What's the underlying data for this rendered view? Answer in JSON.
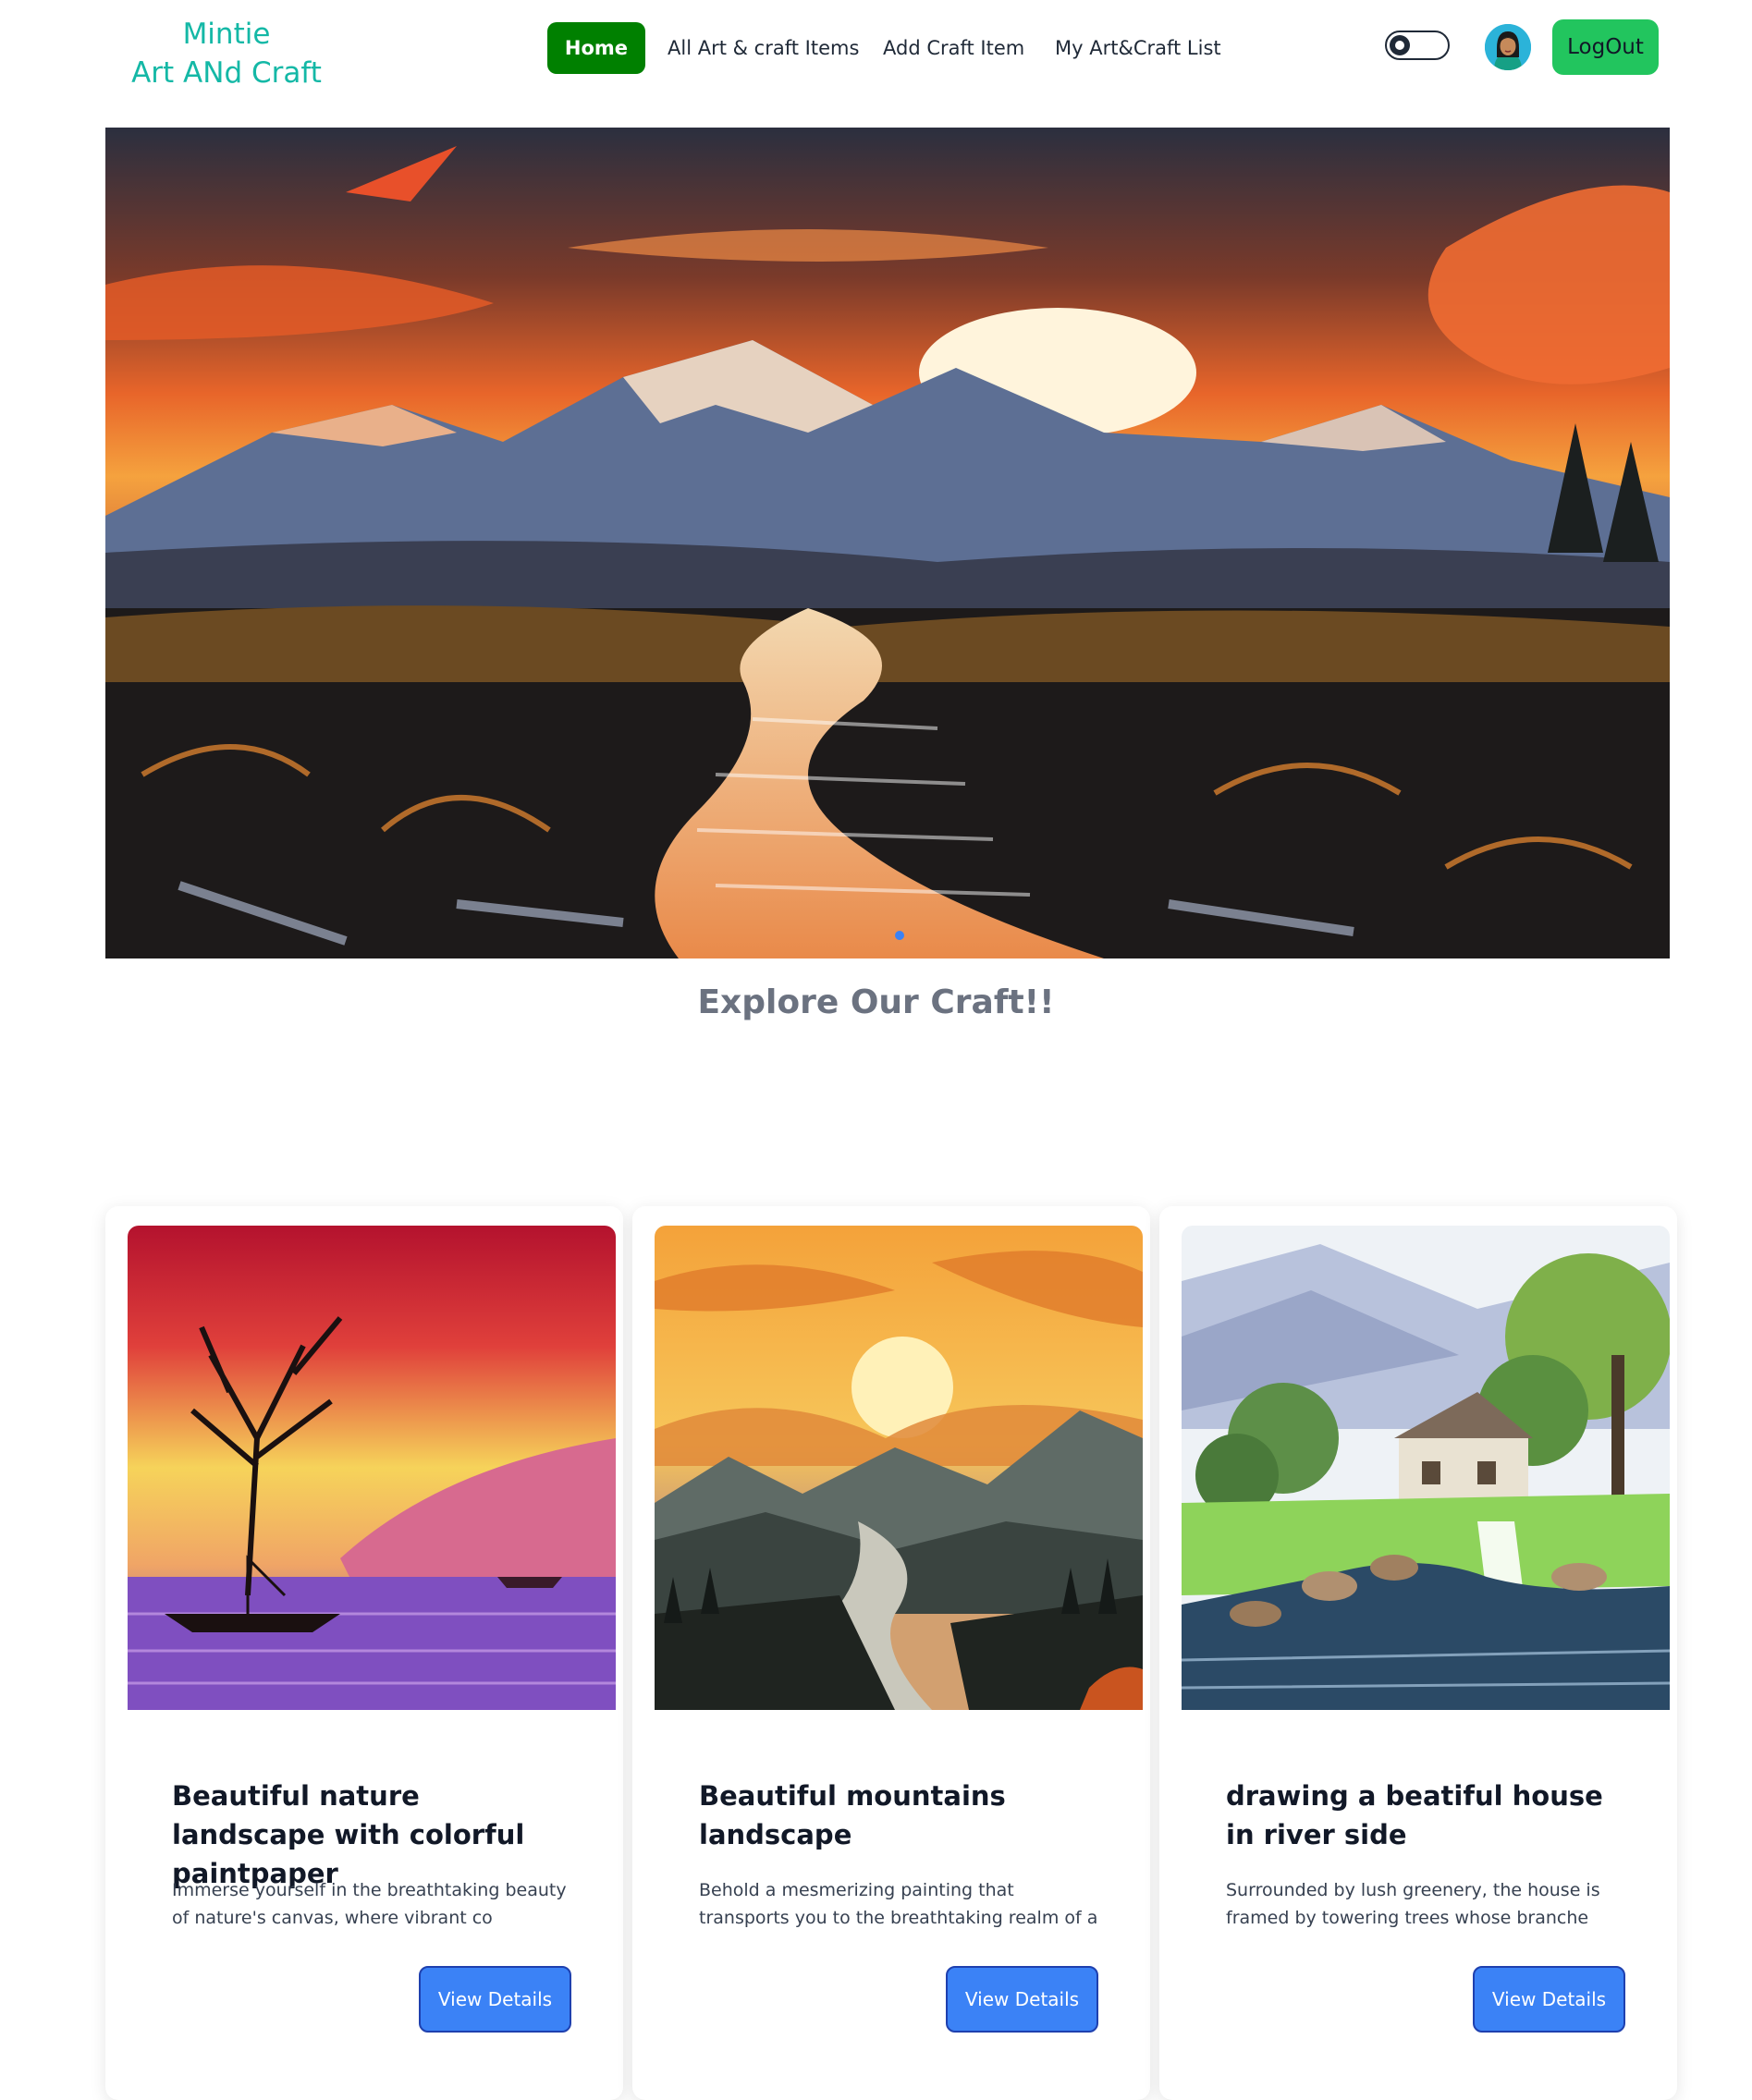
{
  "brand": {
    "line1": "Mintie",
    "line2": "Art ANd Craft"
  },
  "nav": {
    "home": "Home",
    "all_items": "All Art & craft Items",
    "add_item": "Add Craft Item",
    "my_list": "My Art&Craft List"
  },
  "header": {
    "logout_label": "LogOut"
  },
  "hero": {
    "image": "sunset-mountain-river-painting"
  },
  "section": {
    "title": "Explore Our Craft!!"
  },
  "cards": [
    {
      "title": "Beautiful nature landscape with colorful paintpaper",
      "description": "Immerse yourself in the breathtaking beauty of nature's canvas, where vibrant co",
      "button": "View Details",
      "image": "tree-lake-sunset-painting"
    },
    {
      "title": "Beautiful mountains landscape",
      "description": "Behold a mesmerizing painting that transports you to the breathtaking realm of a",
      "button": "View Details",
      "image": "mountain-sunset-painting"
    },
    {
      "title": "drawing a beatiful house in river side",
      "description": "Surrounded by lush greenery, the house is framed by towering trees whose branche",
      "button": "View Details",
      "image": "riverside-house-watercolor"
    }
  ],
  "colors": {
    "brand": "#14b8a6",
    "home_active": "#008000",
    "logout": "#22c55e",
    "primary_button": "#3b82f6",
    "section_title": "#6b7280"
  }
}
